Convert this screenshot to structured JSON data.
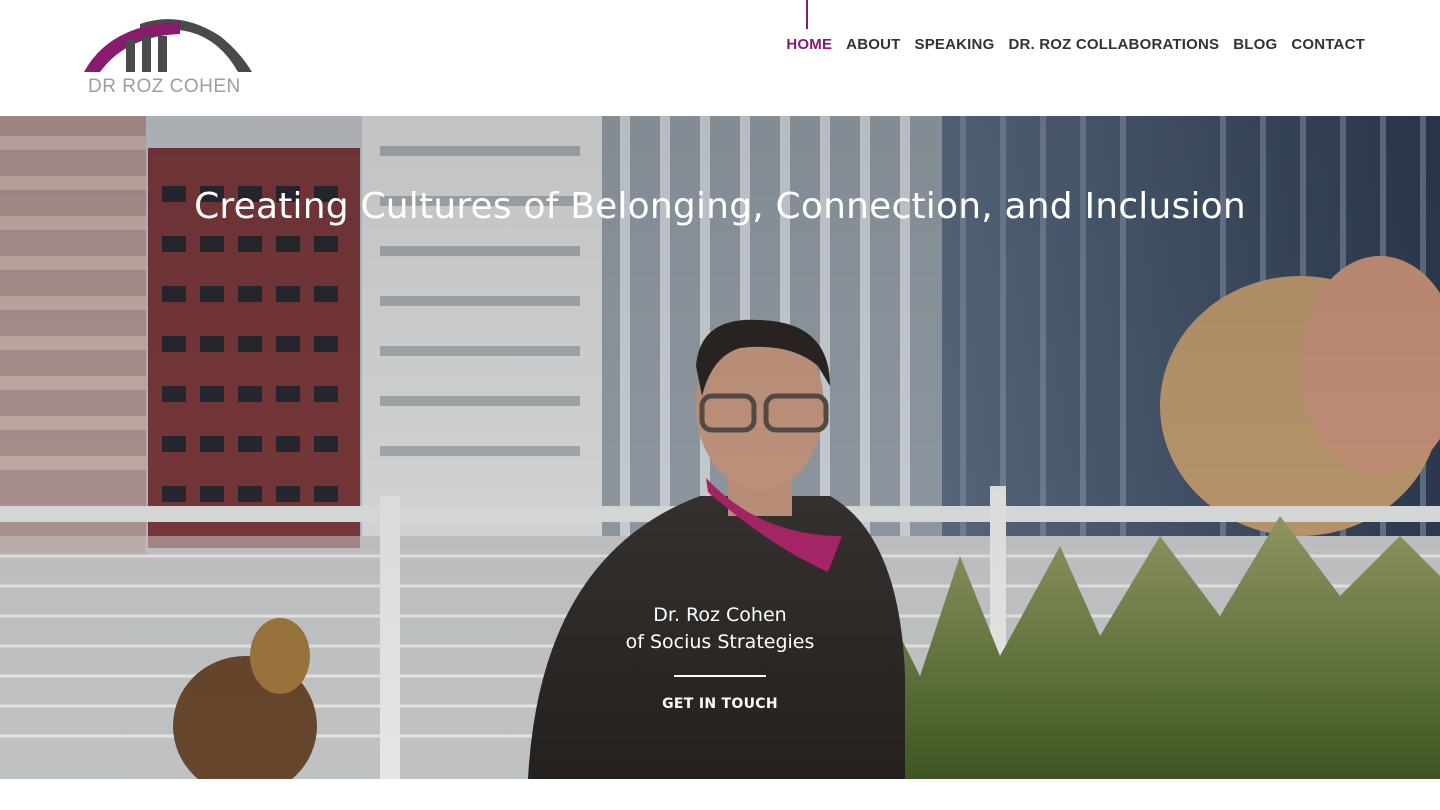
{
  "site": {
    "logo_text": "DR ROZ COHEN"
  },
  "nav": {
    "items": [
      {
        "label": "HOME",
        "active": true
      },
      {
        "label": "ABOUT",
        "active": false
      },
      {
        "label": "SPEAKING",
        "active": false
      },
      {
        "label": "DR. ROZ COLLABORATIONS",
        "active": false
      },
      {
        "label": "BLOG",
        "active": false
      },
      {
        "label": "CONTACT",
        "active": false
      }
    ]
  },
  "hero": {
    "title": "Creating Cultures of Belonging, Connection, and Inclusion",
    "name_line1": "Dr. Roz Cohen",
    "name_line2": "of Socius Strategies",
    "cta_label": "GET IN TOUCH"
  },
  "colors": {
    "brand_magenta": "#8a1a6e",
    "logo_gray": "#4a4a4a",
    "text_dark": "#333333"
  },
  "icons": {
    "logo": "bridge-arch-logo"
  }
}
